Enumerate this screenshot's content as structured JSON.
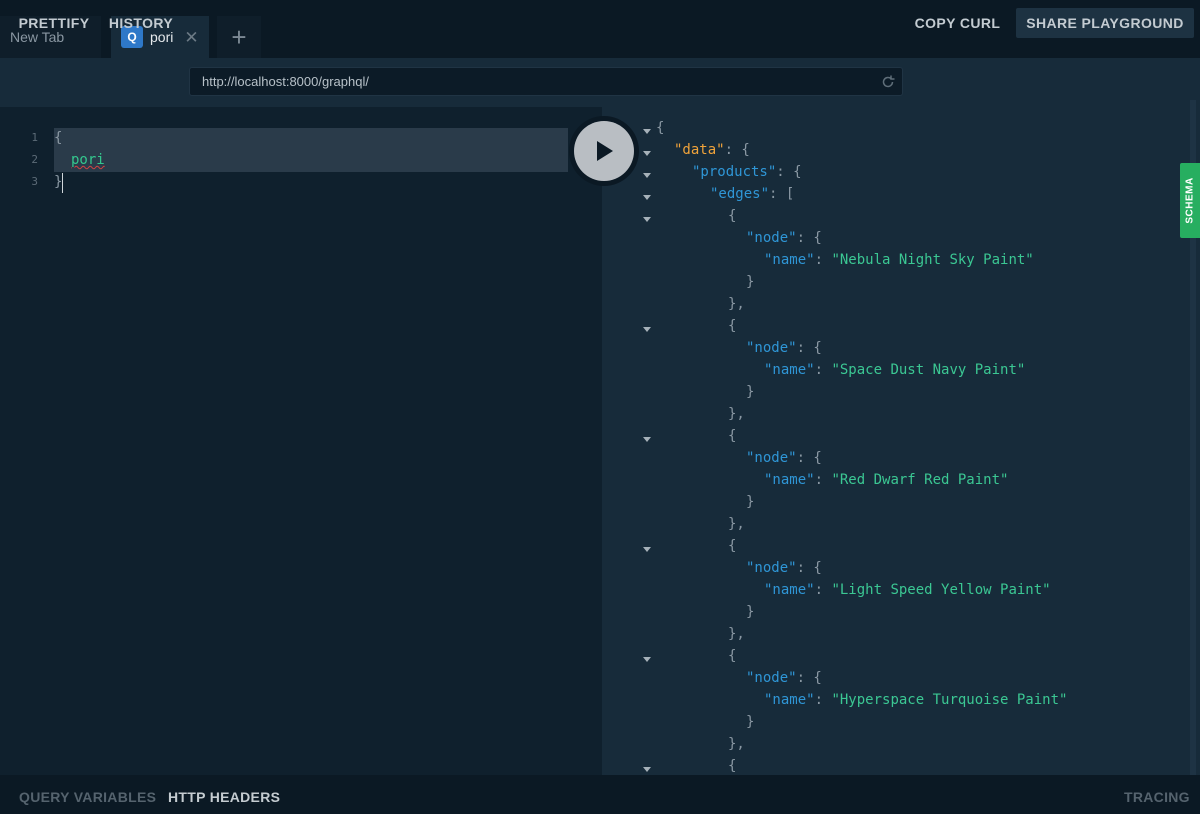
{
  "tabs": [
    {
      "label": "New Tab",
      "active": false
    },
    {
      "label": "pori",
      "active": true,
      "badge": "Q"
    }
  ],
  "toolbar": {
    "prettify": "PRETTIFY",
    "history": "HISTORY",
    "url": "http://localhost:8000/graphql/",
    "copy_curl": "COPY CURL",
    "share_playground": "SHARE PLAYGROUND"
  },
  "editor": {
    "line_numbers": [
      "1",
      "2",
      "3"
    ],
    "lines": [
      "{",
      "pori",
      "}"
    ]
  },
  "results": {
    "keys": {
      "data": "\"data\"",
      "products": "\"products\"",
      "edges": "\"edges\"",
      "node": "\"node\"",
      "name": "\"name\""
    },
    "nodes": [
      "\"Nebula Night Sky Paint\"",
      "\"Space Dust Navy Paint\"",
      "\"Red Dwarf Red Paint\"",
      "\"Light Speed Yellow Paint\"",
      "\"Hyperspace Turquoise Paint\""
    ]
  },
  "side_tabs": {
    "schema": "SCHEMA"
  },
  "footer": {
    "query_variables": "QUERY VARIABLES",
    "http_headers": "HTTP HEADERS",
    "tracing": "TRACING"
  },
  "colors": {
    "background": "#0f202d",
    "results_background": "#172b3a",
    "json_key": "#2f96d6",
    "json_data_key": "#f0a33a",
    "json_string": "#3bc793",
    "schema_tab": "#27ae60",
    "tab_badge": "#2e78c8"
  },
  "icons": [
    "settings-gear-icon",
    "reload-icon",
    "play-icon",
    "close-icon",
    "plus-icon",
    "fold-arrow-icon"
  ]
}
